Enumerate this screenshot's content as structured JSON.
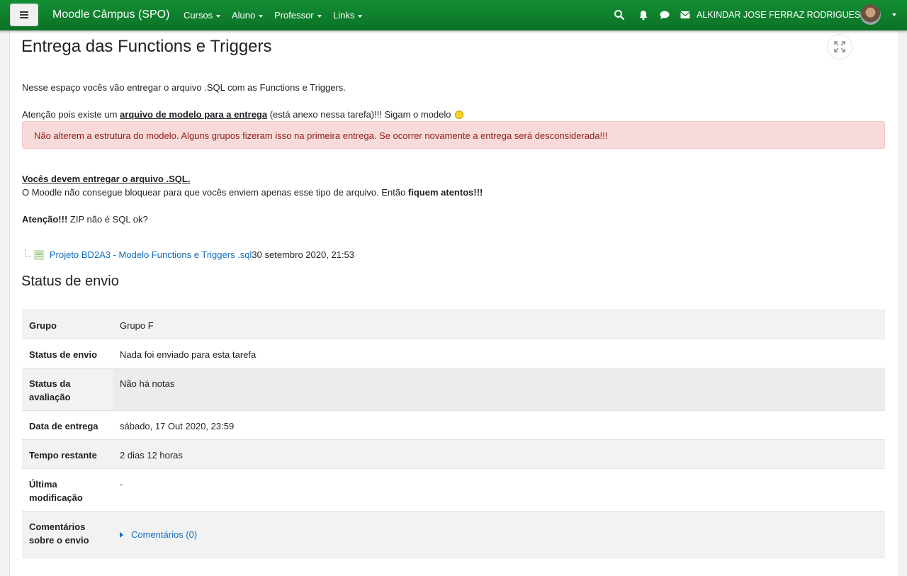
{
  "navbar": {
    "menu_icon": "hamburger-icon",
    "brand": "Moodle Câmpus (SPO)",
    "menus": [
      "Cursos",
      "Aluno",
      "Professor",
      "Links"
    ],
    "icons": [
      "search-icon",
      "bell-icon",
      "chat-bubble-icon",
      "envelope-icon"
    ],
    "user_name": "ALKINDAR JOSE FERRAZ RODRIGUES",
    "accent_color": "#0e7d2c"
  },
  "page": {
    "title": "Entrega das Functions e Triggers",
    "expand_icon": "expand-icon",
    "intro": "Nesse espaço vocês vão entregar o arquivo .SQL com as Functions e Triggers.",
    "attention_prefix": "Atenção pois existe um ",
    "attention_link": "arquivo de modelo para a entrega",
    "attention_suffix": " (está anexo nessa tarefa)!!! Sigam o modelo",
    "alert": "Não alterem a estrutura do modelo. Alguns grupos fizeram isso na primeira entrega. Se ocorrer novamente a entrega será desconsiderada!!!",
    "must_deliver": "Vocês devem entregar o arquivo .SQL.",
    "moodle_note_prefix": "O Moodle não consegue bloquear para que vocês enviem apenas esse tipo de arquivo. Então ",
    "moodle_note_bold": "fiquem atentos!!!",
    "zip_bold": "Atenção!!!",
    "zip_rest": " ZIP não é SQL ok?",
    "attachment": {
      "name": "Projeto BD2A3 - Modelo Functions e Triggers .sql",
      "date": "30 setembro 2020, 21:53"
    },
    "status_heading": "Status de envio"
  },
  "status_table": [
    {
      "label": "Grupo",
      "value": "Grupo F"
    },
    {
      "label": "Status de envio",
      "value": "Nada foi enviado para esta tarefa"
    },
    {
      "label": "Status da avaliação",
      "value": "Não há notas"
    },
    {
      "label": "Data de entrega",
      "value": "sábado, 17 Out 2020, 23:59"
    },
    {
      "label": "Tempo restante",
      "value": "2 dias 12 horas"
    },
    {
      "label": "Última modificação",
      "value": "-"
    },
    {
      "label": "Comentários sobre o envio",
      "value": "Comentários (0)"
    }
  ]
}
